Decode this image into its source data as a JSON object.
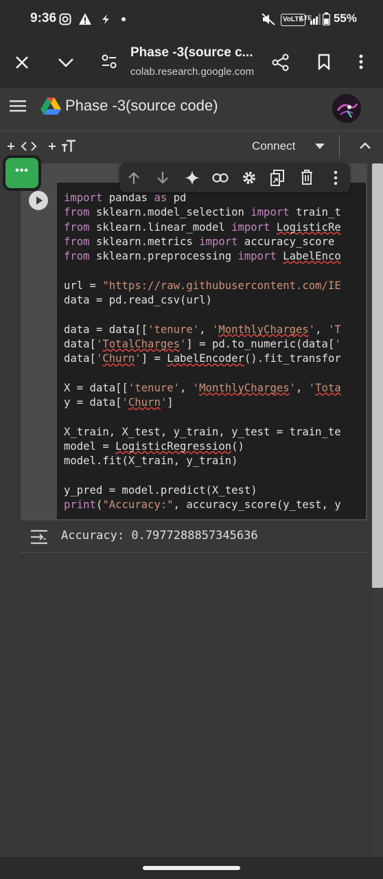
{
  "status_bar": {
    "time": "9:36",
    "battery": "55%",
    "volte_badge": "VoLTE",
    "lte_label": "LTE"
  },
  "browser": {
    "page_title": "Phase -3(source c...",
    "url": "colab.research.google.com"
  },
  "notebook": {
    "title": "Phase -3(source code)",
    "connect_label": "Connect",
    "accent_color": "#34a853"
  },
  "cell": {
    "code_lines": [
      "import pandas as pd",
      "from sklearn.model_selection import train_t",
      "from sklearn.linear_model import LogisticRe",
      "from sklearn.metrics import accuracy_score",
      "from sklearn.preprocessing import LabelEnco",
      "",
      "url = \"https://raw.githubusercontent.com/IE",
      "data = pd.read_csv(url)",
      "",
      "data = data[['tenure', 'MonthlyCharges', 'T",
      "data['TotalCharges'] = pd.to_numeric(data['",
      "data['Churn'] = LabelEncoder().fit_transfor",
      "",
      "X = data[['tenure', 'MonthlyCharges', 'Tota",
      "y = data['Churn']",
      "",
      "X_train, X_test, y_train, y_test = train_te",
      "model = LogisticRegression()",
      "model.fit(X_train, y_train)",
      "",
      "y_pred = model.predict(X_test)",
      "print(\"Accuracy:\", accuracy_score(y_test, y"
    ],
    "output": "Accuracy: 0.7977288857345636"
  },
  "icons": {
    "close": "close-icon",
    "collapse": "chevron-down-icon",
    "page_info": "tune-icon",
    "share": "share-icon",
    "bookmark": "bookmark-icon",
    "more": "more-vert-icon",
    "drive": "google-drive-icon",
    "run": "play-circle-icon"
  }
}
